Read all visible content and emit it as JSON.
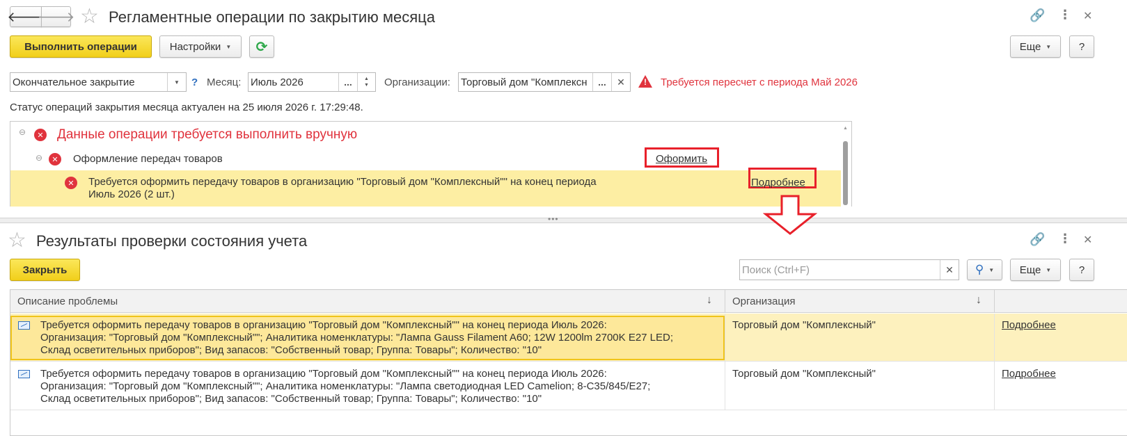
{
  "top_window": {
    "title": "Регламентные операции по закрытию месяца",
    "toolbar": {
      "run_label": "Выполнить операции",
      "settings_label": "Настройки",
      "more_label": "Еще",
      "help_label": "?"
    },
    "filters": {
      "mode_value": "Окончательное закрытие",
      "help_mark": "?",
      "month_label": "Месяц:",
      "month_value": "Июль 2026",
      "dots": "...",
      "org_label": "Организации:",
      "org_value": "Торговый дом \"Комплексн",
      "warning": "Требуется пересчет с периода Май 2026"
    },
    "status_text": "Статус операций закрытия месяца актуален на 25 июля 2026 г. 17:29:48.",
    "tree": {
      "group_title": "Данные операции требуется выполнить вручную",
      "item_title": "Оформление передач товаров",
      "item_action": "Оформить",
      "detail_line1": "Требуется оформить передачу товаров в организацию \"Торговый дом \"Комплексный\"\" на конец периода",
      "detail_line2": "Июль 2026 (2 шт.)",
      "detail_action": "Подробнее"
    }
  },
  "bottom_window": {
    "title": "Результаты проверки состояния учета",
    "toolbar": {
      "close_label": "Закрыть",
      "more_label": "Еще",
      "help_label": "?"
    },
    "search": {
      "placeholder": "Поиск (Ctrl+F)"
    },
    "table": {
      "columns": [
        "Описание проблемы",
        "Организация"
      ],
      "rows": [
        {
          "line1": "Требуется оформить передачу товаров в организацию \"Торговый дом \"Комплексный\"\" на конец периода Июль 2026:",
          "line2": "Организация: \"Торговый дом \"Комплексный\"\"; Аналитика номенклатуры: \"Лампа Gauss Filament A60; 12W 1200lm 2700K E27 LED;",
          "line3": "Склад осветительных приборов\"; Вид запасов: \"Собственный товар; Группа: Товары\"; Количество: \"10\"",
          "organization": "Торговый дом \"Комплексный\"",
          "action": "Подробнее"
        },
        {
          "line1": "Требуется оформить передачу товаров в организацию \"Торговый дом \"Комплексный\"\" на конец периода Июль 2026:",
          "line2": "Организация: \"Торговый дом \"Комплексный\"\"; Аналитика номенклатуры: \"Лампа светодиодная LED Camelion; 8-C35/845/E27;",
          "line3": "Склад осветительных приборов\"; Вид запасов: \"Собственный товар; Группа: Товары\"; Количество: \"10\"",
          "organization": "Торговый дом \"Комплексный\"",
          "action": "Подробнее"
        }
      ]
    }
  },
  "colors": {
    "accent_yellow": "#f4d320",
    "highlight_row": "#fdeea3",
    "error_red": "#e0333d",
    "annotation_red": "#e8202a"
  }
}
